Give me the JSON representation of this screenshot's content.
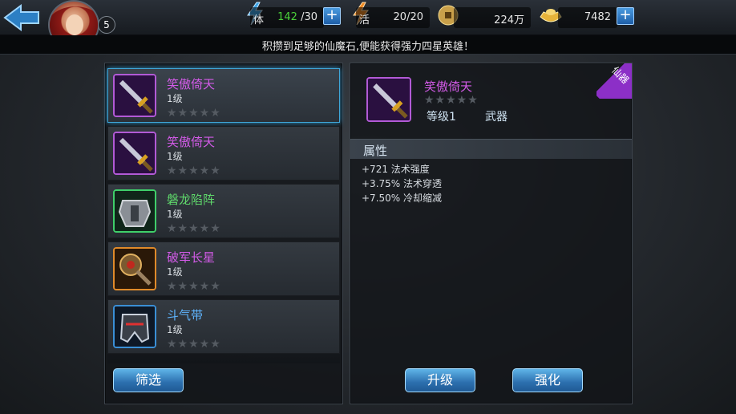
{
  "player": {
    "level": "5"
  },
  "resources": {
    "stamina": {
      "icon": "lightning-icon",
      "label": "体",
      "current": "142",
      "max": "/30"
    },
    "activity": {
      "icon": "lightning-orange-icon",
      "label": "活",
      "value": "20/20"
    },
    "coins": {
      "icon": "coin-icon",
      "value": "224万"
    },
    "ingots": {
      "icon": "gold-ingot-icon",
      "value": "7482"
    }
  },
  "notice": "积攒到足够的仙魔石,便能获得强力四星英雄！",
  "equipment_list": [
    {
      "name": "笑傲倚天",
      "level": "1级",
      "stars": "★★★★★",
      "rarity": "purple",
      "icon": "sword-icon",
      "selected": true
    },
    {
      "name": "笑傲倚天",
      "level": "1级",
      "stars": "★★★★★",
      "rarity": "purple",
      "icon": "sword-icon",
      "selected": false
    },
    {
      "name": "磐龙陷阵",
      "level": "1级",
      "stars": "★★★★★",
      "rarity": "green",
      "icon": "armor-icon",
      "selected": false
    },
    {
      "name": "破军长星",
      "level": "1级",
      "stars": "★★★★★",
      "rarity": "orange",
      "icon": "mace-icon",
      "selected": false
    },
    {
      "name": "斗气带",
      "level": "1级",
      "stars": "★★★★★",
      "rarity": "blue",
      "icon": "helmet-icon",
      "selected": false
    }
  ],
  "filter_label": "筛选",
  "detail": {
    "name": "笑傲倚天",
    "stars": "★★★★★",
    "level": "等级1",
    "type": "武器",
    "tag": "仙器",
    "attr_title": "属性",
    "attributes": [
      "+721 法术强度",
      "+3.75% 法术穿透",
      "+7.50% 冷却缩减"
    ]
  },
  "actions": {
    "upgrade_label": "升级",
    "enhance_label": "强化"
  },
  "colors": {
    "rarity_purple": "#d35be8",
    "rarity_green": "#5fd86b",
    "accent_blue": "#3fa6d8"
  }
}
